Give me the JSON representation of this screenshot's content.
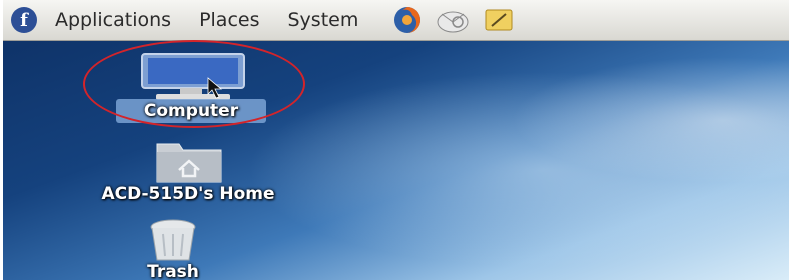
{
  "panel": {
    "menus": [
      "Applications",
      "Places",
      "System"
    ],
    "launchers": [
      "firefox-icon",
      "mail-icon",
      "notes-icon"
    ]
  },
  "desktop": {
    "icons": [
      {
        "label": "Computer",
        "icon": "computer-icon",
        "selected": true
      },
      {
        "label": "ACD-515D's Home",
        "icon": "home-folder-icon",
        "selected": false
      },
      {
        "label": "Trash",
        "icon": "trash-icon",
        "selected": false
      }
    ]
  },
  "colors": {
    "panel_bg": "#e7e6e1",
    "selection_highlight": "#7aa2d4",
    "annotation_circle": "#d3242a",
    "wallpaper_dark": "#0d2f63",
    "wallpaper_light": "#d9ecf8"
  }
}
